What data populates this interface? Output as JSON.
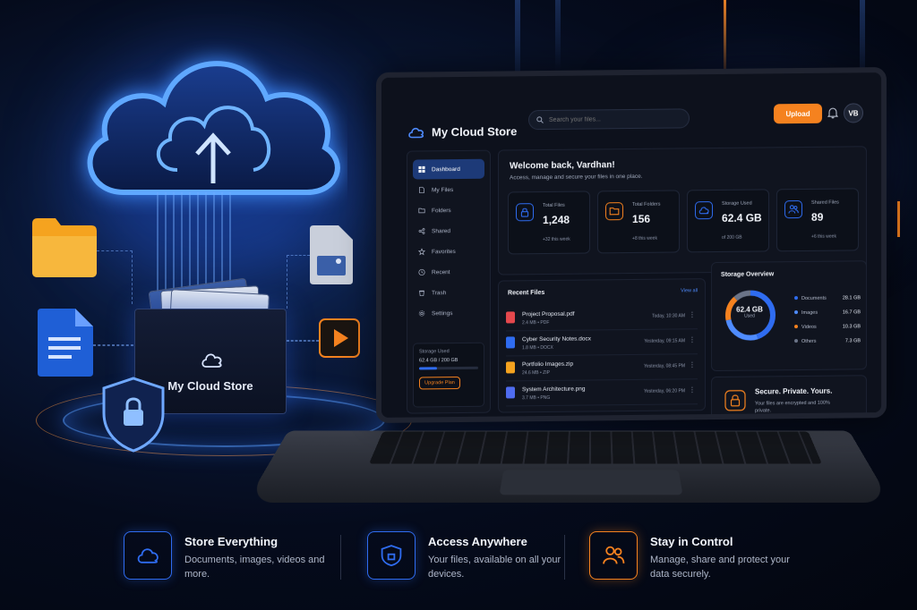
{
  "illustration": {
    "box_label": "My Cloud Store"
  },
  "app": {
    "brand": "My Cloud Store",
    "search_placeholder": "Search your files...",
    "upload_label": "Upload",
    "avatar_initials": "VB",
    "accent": "#f5821f",
    "primary": "#2f6cf0"
  },
  "sidebar": {
    "items": [
      {
        "label": "Dashboard",
        "icon": "grid-icon",
        "active": true
      },
      {
        "label": "My Files",
        "icon": "file-icon"
      },
      {
        "label": "Folders",
        "icon": "folder-icon"
      },
      {
        "label": "Shared",
        "icon": "share-icon"
      },
      {
        "label": "Favorites",
        "icon": "star-icon"
      },
      {
        "label": "Recent",
        "icon": "clock-icon"
      },
      {
        "label": "Trash",
        "icon": "trash-icon"
      },
      {
        "label": "Settings",
        "icon": "gear-icon"
      }
    ],
    "storage": {
      "label": "Storage Used",
      "value": "62.4 GB / 200 GB",
      "fraction": 0.31,
      "upgrade_label": "Upgrade Plan"
    }
  },
  "welcome": {
    "title": "Welcome back, Vardhan!",
    "subtitle": "Access, manage and secure your files in one place."
  },
  "stats": [
    {
      "label": "Total Files",
      "value": "1,248",
      "note": "+32 this week",
      "icon": "lock-icon",
      "color": "#2f6cf0"
    },
    {
      "label": "Total Folders",
      "value": "156",
      "note": "+8 this week",
      "icon": "folder-icon",
      "color": "#f5821f"
    },
    {
      "label": "Storage Used",
      "value": "62.4 GB",
      "note": "of 200 GB",
      "icon": "cloud-icon",
      "color": "#2f6cf0"
    },
    {
      "label": "Shared Files",
      "value": "89",
      "note": "+6 this week",
      "icon": "users-icon",
      "color": "#2f6cf0"
    }
  ],
  "recent": {
    "title": "Recent Files",
    "view_all": "View all",
    "files": [
      {
        "name": "Project Proposal.pdf",
        "meta": "2.4 MB • PDF",
        "time": "Today, 10:30 AM",
        "color": "#e5484d"
      },
      {
        "name": "Cyber Security Notes.docx",
        "meta": "1.8 MB • DOCX",
        "time": "Yesterday, 09:15 AM",
        "color": "#2f6cf0"
      },
      {
        "name": "Portfolio Images.zip",
        "meta": "24.6 MB • ZIP",
        "time": "Yesterday, 08:45 PM",
        "color": "#f5a31f"
      },
      {
        "name": "System Architecture.png",
        "meta": "3.7 MB • PNG",
        "time": "Yesterday, 06:20 PM",
        "color": "#4f6cf0"
      }
    ]
  },
  "overview": {
    "title": "Storage Overview",
    "center_value": "62.4 GB",
    "center_label": "Used",
    "segments": [
      {
        "label": "Documents",
        "value": "28.1 GB",
        "amount": 28.1,
        "color": "#2f6cf0"
      },
      {
        "label": "Images",
        "value": "16.7 GB",
        "amount": 16.7,
        "color": "#4f8cff"
      },
      {
        "label": "Videos",
        "value": "10.3 GB",
        "amount": 10.3,
        "color": "#f5821f"
      },
      {
        "label": "Others",
        "value": "7.3 GB",
        "amount": 7.3,
        "color": "#6b7488"
      }
    ]
  },
  "secure": {
    "title": "Secure. Private. Yours.",
    "subtitle": "Your files are encrypted and 100% private."
  },
  "features": [
    {
      "title": "Store Everything",
      "desc": "Documents, images, videos and more.",
      "icon": "cloud-icon",
      "color": "#2f6cf0"
    },
    {
      "title": "Access Anywhere",
      "desc": "Your files, available on all your devices.",
      "icon": "shield-icon",
      "color": "#2f6cf0"
    },
    {
      "title": "Stay in Control",
      "desc": "Manage, share and protect your data securely.",
      "icon": "users-icon",
      "color": "#f5821f"
    }
  ]
}
